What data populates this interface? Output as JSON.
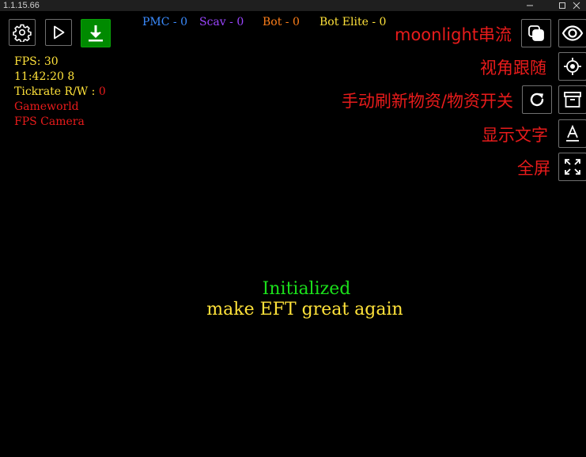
{
  "window": {
    "version": "1.1.15.66"
  },
  "toolbar": {
    "left_icons": [
      "gear-icon",
      "play-icon",
      "download-icon"
    ]
  },
  "counts": [
    {
      "label": "PMC - 0",
      "color": "#3b8cff"
    },
    {
      "label": "Scav - 0",
      "color": "#9b45ff"
    },
    {
      "label": "Bot - 0",
      "color": "#ff7f1a"
    },
    {
      "label": "Bot Elite - 0",
      "color": "#ffe23a"
    }
  ],
  "stats": {
    "fps": "FPS: 30",
    "time": "11:42:20 8",
    "tickrate_label": "Tickrate R/W : ",
    "tickrate_value": "0",
    "gameworld": "Gameworld",
    "camera": "FPS Camera"
  },
  "controls": [
    {
      "label": "moonlight串流",
      "icon": "window-copy-icon"
    },
    {
      "label": "视角跟随",
      "icon": "crosshair-icon"
    },
    {
      "label": "手动刷新物资/物资开关",
      "icon": "refresh-icon"
    },
    {
      "label": "显示文字",
      "icon": "text-icon"
    },
    {
      "label": "全屏",
      "icon": "fullscreen-icon"
    }
  ],
  "extra_icons": [
    "eye-icon",
    "archive-icon"
  ],
  "center": {
    "status": "Initialized",
    "tagline": "make EFT great again"
  },
  "colors": {
    "accent_green": "#008a00",
    "label_red": "#e81b1b",
    "stats_yellow": "#ffe23a",
    "status_green": "#1be01b"
  }
}
